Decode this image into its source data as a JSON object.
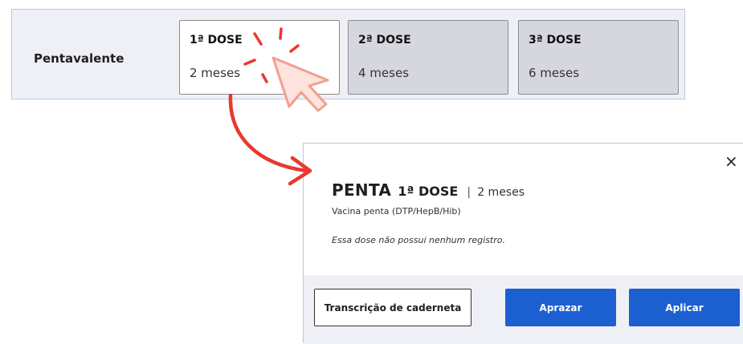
{
  "row": {
    "label": "Pentavalente",
    "doses": [
      {
        "title": "1ª DOSE",
        "age": "2 meses",
        "selected": true
      },
      {
        "title": "2ª DOSE",
        "age": "4 meses",
        "selected": false
      },
      {
        "title": "3ª DOSE",
        "age": "6 meses",
        "selected": false
      }
    ]
  },
  "modal": {
    "close": "×",
    "vaccine": "PENTA",
    "dose": "1ª DOSE",
    "separator": "|",
    "age": "2 meses",
    "subtitle": "Vacina penta (DTP/HepB/Hib)",
    "note": "Essa dose não possui nenhum registro.",
    "buttons": {
      "transcricao": "Transcrição de caderneta",
      "aprazar": "Aprazar",
      "aplicar": "Aplicar"
    }
  },
  "colors": {
    "primary": "#1c5fd1",
    "annotation": "#e8392c",
    "row_bg": "#eef0f6",
    "card_disabled": "#d6d6df"
  },
  "icons": [
    "cursor-arrow-icon",
    "click-burst-icon",
    "curved-arrow-icon",
    "close-icon"
  ]
}
